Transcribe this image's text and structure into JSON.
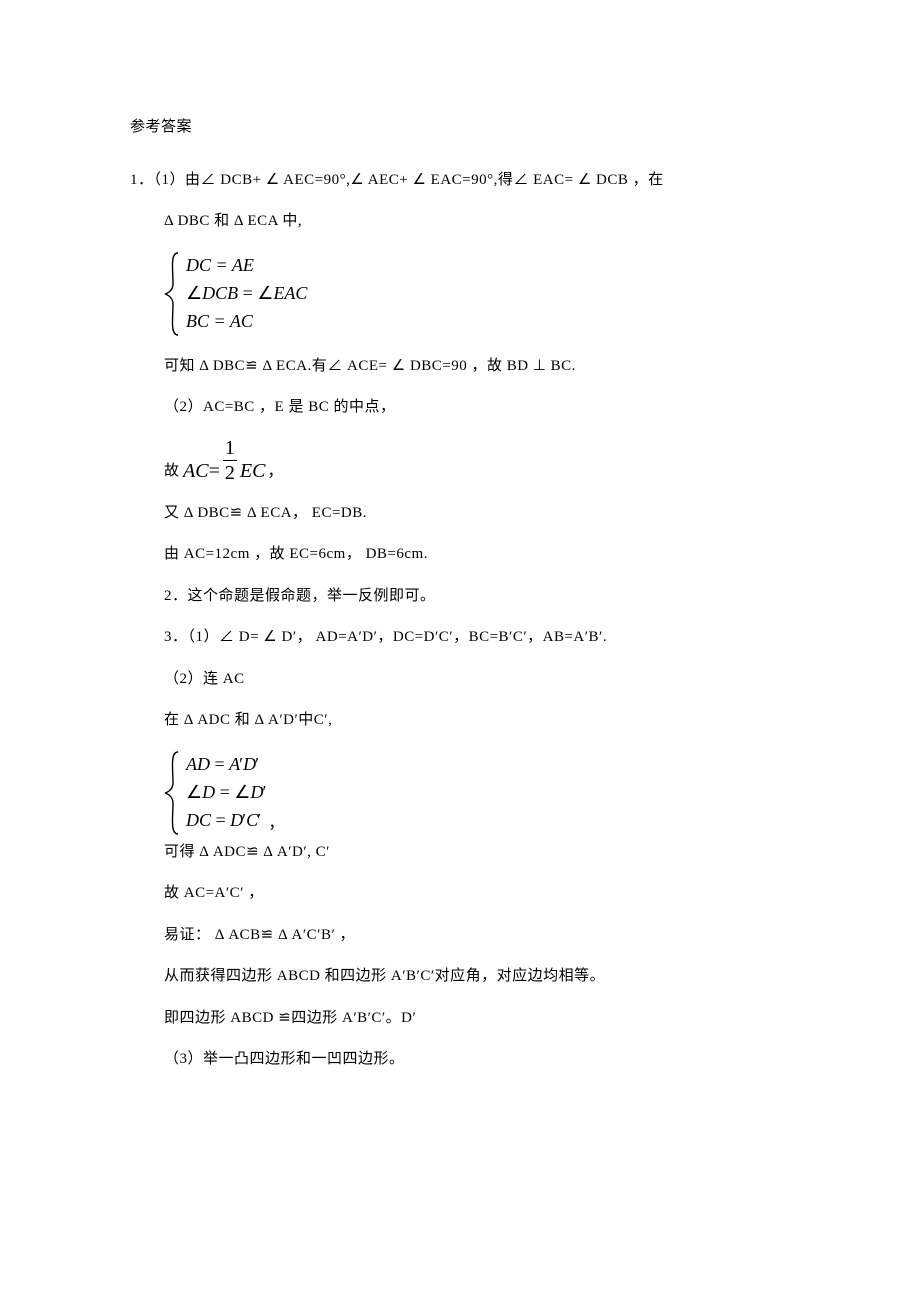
{
  "title": "参考答案",
  "p1_l1": "1．（1）由∠ DCB+ ∠ AEC=90°,∠ AEC+ ∠ EAC=90°,得∠ EAC= ∠ DCB ，在",
  "p1_l2": "Δ DBC 和 Δ ECA 中,",
  "cases1": {
    "r1": "DC = AE",
    "r2_pre": "∠",
    "r2_a": "DCB",
    "r2_eq": " = ",
    "r2_b": "∠",
    "r2_c": "EAC",
    "r3": "BC = AC"
  },
  "p1_l3": "可知 Δ DBC≌ Δ ECA.有∠ ACE= ∠ DBC=90 ，故 BD ⊥ BC.",
  "p1_l4": "（2）AC=BC ，E 是 BC 的中点，",
  "frac": {
    "pre": "故",
    "lhs": "AC",
    "eq": " = ",
    "num": "1",
    "den": "2",
    "rhs": "EC",
    "comma": "，"
  },
  "p1_l5": "又 Δ DBC≌ Δ ECA， EC=DB.",
  "p1_l6": "由 AC=12cm ，故 EC=6cm， DB=6cm.",
  "p2": "2．这个命题是假命题，举一反例即可。",
  "p3_l1": "3．（1）∠ D= ∠ D′， AD=A′D′，DC=D′C′，BC=B′C′，AB=A′B′.",
  "p3_l2": "（2）连 AC",
  "p3_l3": "在 Δ ADC 和 Δ A′D′中C′,",
  "cases2": {
    "r1_a": "AD",
    "r1_eq": " = ",
    "r1_b": "A",
    "r1_bp": "′",
    "r1_c": "D",
    "r1_cp": "′",
    "r2_a": "∠",
    "r2_b": "D",
    "r2_eq": " = ",
    "r2_c": "∠",
    "r2_d": "D",
    "r2_dp": "′",
    "r3_a": "DC",
    "r3_eq": " = ",
    "r3_b": "D",
    "r3_bp": "′",
    "r3_c": "C",
    "r3_cp": "′"
  },
  "cases2_tail": "，",
  "p3_l4": "可得 Δ ADC≌ Δ A′D′, C′",
  "p3_l5": "故 AC=A′C′ ，",
  "p3_l6": "易证： Δ ACB≌ Δ A′C′B′ ，",
  "p3_l7": "从而获得四边形  ABCD 和四边形  A′B′C′对应角，对应边均相等。",
  "p3_l8": "即四边形 ABCD ≌四边形  A′B′C′。D′",
  "p3_l9": "（3）举一凸四边形和一凹四边形。"
}
